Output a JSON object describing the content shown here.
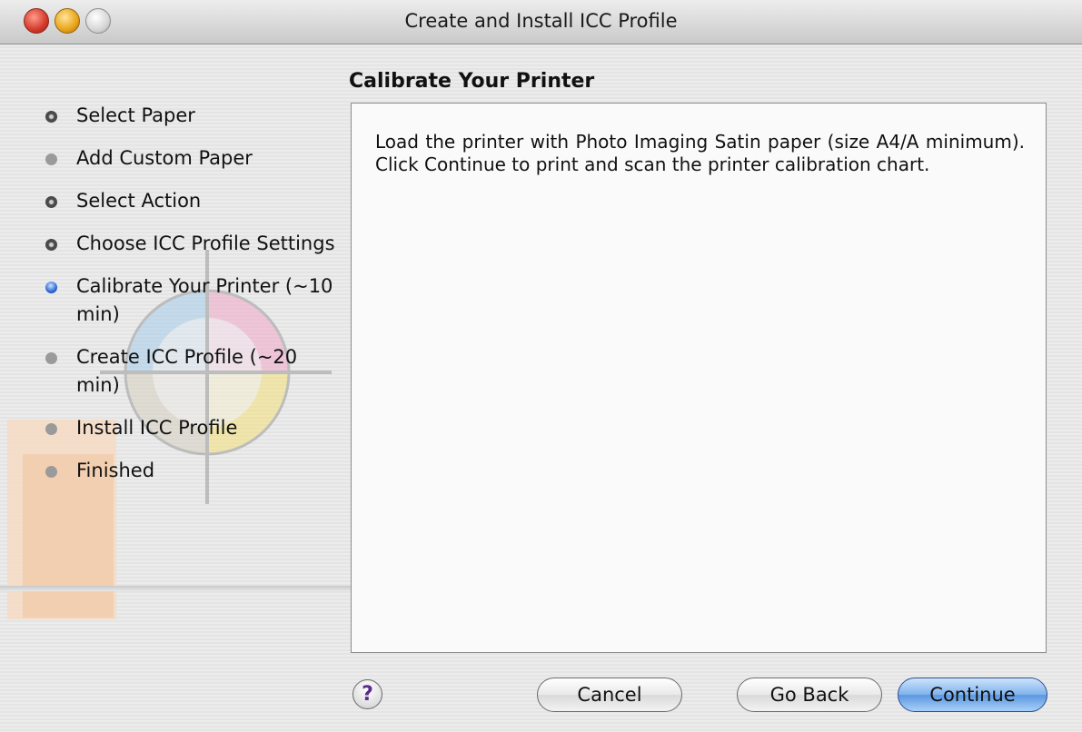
{
  "window": {
    "title": "Create and Install ICC Profile"
  },
  "steps": [
    {
      "label": "Select Paper",
      "state": "done"
    },
    {
      "label": "Add Custom Paper",
      "state": "pending"
    },
    {
      "label": "Select Action",
      "state": "done"
    },
    {
      "label": "Choose ICC Profile Settings",
      "state": "done"
    },
    {
      "label": "Calibrate Your Printer (~10 min)",
      "state": "current"
    },
    {
      "label": "Create ICC Profile (~20 min)",
      "state": "pending"
    },
    {
      "label": "Install ICC Profile",
      "state": "pending"
    },
    {
      "label": "Finished",
      "state": "pending"
    }
  ],
  "panel": {
    "title": "Calibrate Your Printer",
    "message": "Load the printer with Photo Imaging Satin paper (size A4/A minimum). Click Continue to print and scan the printer calibration chart."
  },
  "buttons": {
    "help": "?",
    "cancel": "Cancel",
    "go_back": "Go Back",
    "continue": "Continue"
  },
  "colors": {
    "current_step_bullet": "#2a66d6",
    "default_button": "#7fb2ec"
  }
}
